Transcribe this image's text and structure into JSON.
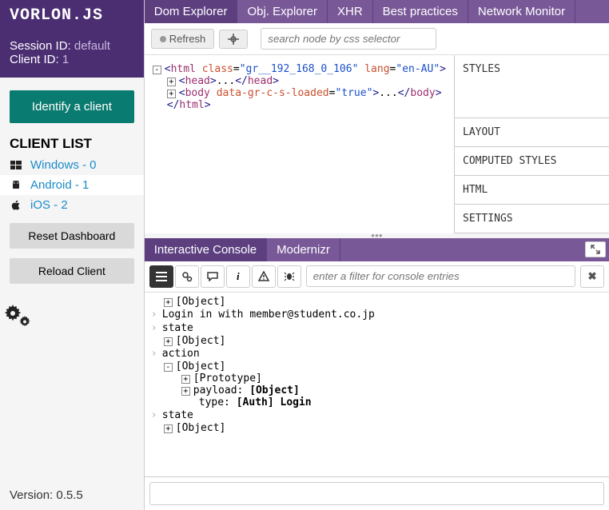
{
  "logo": "VORLON.JS",
  "session": {
    "id_label": "Session ID:",
    "id_value": "default",
    "client_label": "Client ID:",
    "client_value": "1"
  },
  "identify_btn": "Identify a client",
  "client_list_header": "CLIENT LIST",
  "clients": [
    {
      "label": "Windows - 0"
    },
    {
      "label": "Android - 1"
    },
    {
      "label": "iOS - 2"
    }
  ],
  "reset_btn": "Reset Dashboard",
  "reload_btn": "Reload Client",
  "version": "Version: 0.5.5",
  "top_tabs": [
    "Dom Explorer",
    "Obj. Explorer",
    "XHR",
    "Best practices",
    "Network Monitor"
  ],
  "toolbar": {
    "refresh": "Refresh",
    "search_placeholder": "search node by css selector"
  },
  "right_sections": [
    "STYLES",
    "LAYOUT",
    "COMPUTED STYLES",
    "HTML",
    "SETTINGS"
  ],
  "lower_tabs": [
    "Interactive Console",
    "Modernizr"
  ],
  "console": {
    "filter_placeholder": "enter a filter for console entries"
  },
  "dom": {
    "html_class": "gr__192_168_0_106",
    "html_lang": "en-AU",
    "body_attr": "data-gr-c-s-loaded",
    "body_val": "true"
  },
  "logs": {
    "object": "[Object]",
    "login": "Login in with member@student.co.jp",
    "state": "state",
    "action": "action",
    "proto": "[Prototype]",
    "payload_label": "payload:",
    "payload_val": "[Object]",
    "type_label": "type:",
    "type_val": "[Auth] Login"
  }
}
